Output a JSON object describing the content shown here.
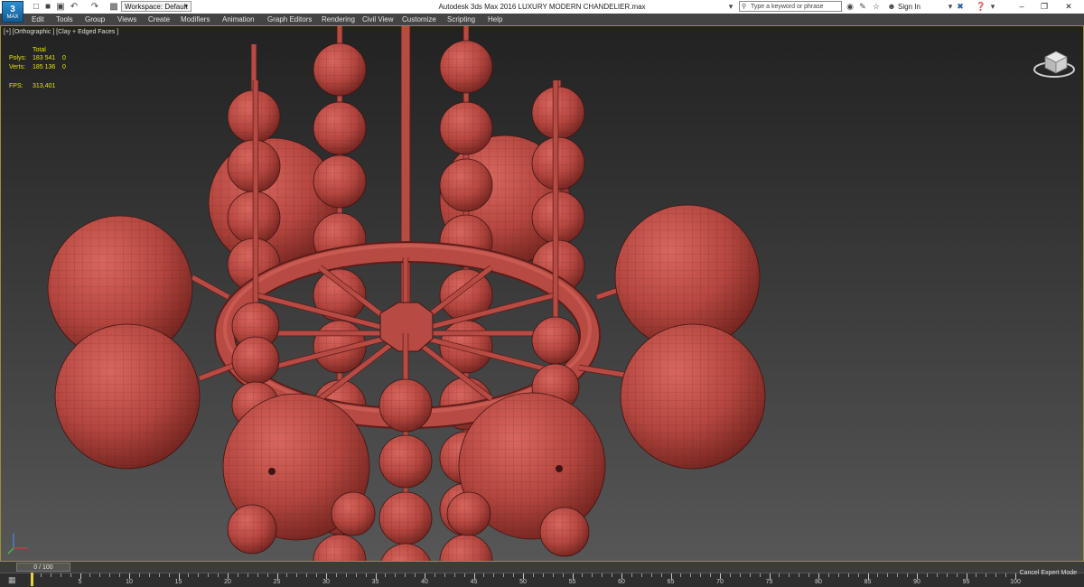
{
  "app": {
    "logo_text": "MAX",
    "window_title": "Autodesk 3ds Max 2016     LUXURY MODERN CHANDELIER.max",
    "workspace_label": "Workspace: Default",
    "search_placeholder": "Type a keyword or phrase",
    "sign_in_label": "Sign In",
    "icons": [
      "new-file-icon",
      "open-file-icon",
      "save-icon",
      "undo-icon",
      "redo-icon",
      "project-folder-icon",
      "search-icon",
      "binoculars-icon",
      "favorites-star-icon",
      "user-icon",
      "exchange-icon",
      "help-icon",
      "minimize-icon",
      "maximize-icon",
      "close-icon"
    ]
  },
  "menu": {
    "items": [
      "Edit",
      "Tools",
      "Group",
      "Views",
      "Create",
      "Modifiers",
      "Animation",
      "Graph Editors",
      "Rendering",
      "Civil View",
      "Customize",
      "Scripting",
      "Help"
    ]
  },
  "viewport": {
    "label": "[+] [Orthographic ] [Clay + Edged Faces ]",
    "stats": {
      "header": "Total",
      "polys_label": "Polys:",
      "polys_value": "183 541",
      "polys_sel": "0",
      "verts_label": "Verts:",
      "verts_value": "185 136",
      "verts_sel": "0",
      "fps_label": "FPS:",
      "fps_value": "313,401"
    },
    "clay_color": "#b4463f",
    "mesh_line_color": "#3d1512"
  },
  "timeline": {
    "slider_label": "0 / 100",
    "cancel_label": "Cancel Expert Mode",
    "ticks": [
      "0",
      "5",
      "10",
      "15",
      "20",
      "25",
      "30",
      "35",
      "40",
      "45",
      "50",
      "55",
      "60",
      "65",
      "70",
      "75",
      "80",
      "85",
      "90",
      "95",
      "100"
    ],
    "accent": "#e8d24a"
  }
}
